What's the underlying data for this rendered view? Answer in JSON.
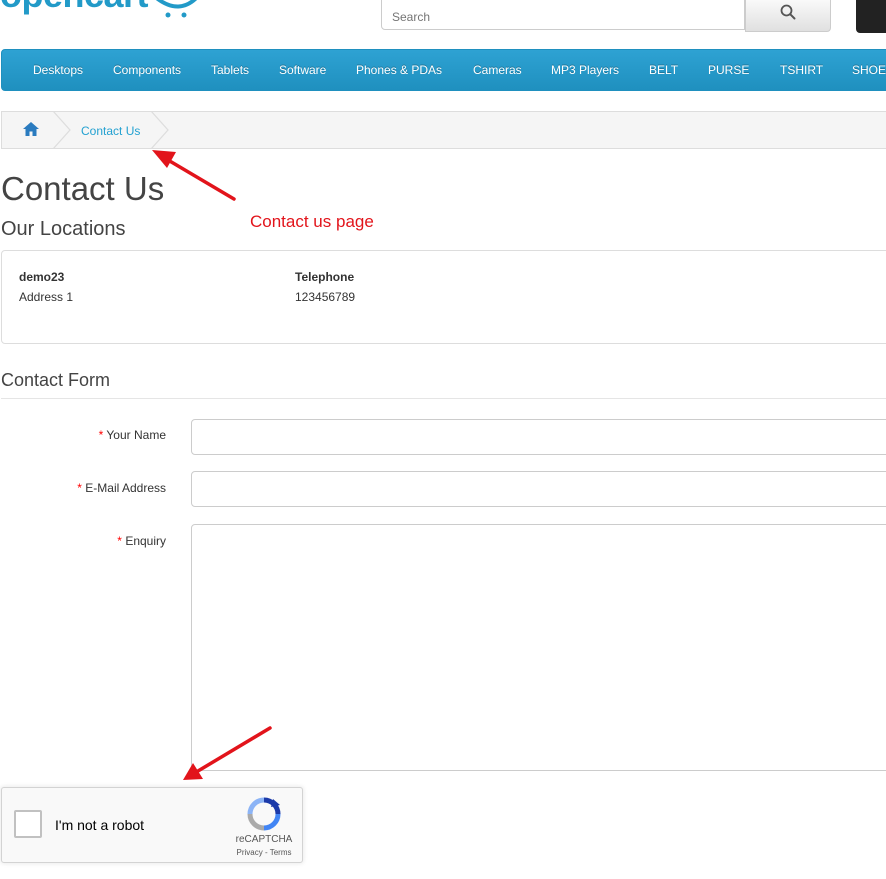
{
  "header": {
    "logo_text": "opencart",
    "search": {
      "placeholder": "Search",
      "value": ""
    }
  },
  "menu": {
    "items": [
      "Desktops",
      "Components",
      "Tablets",
      "Software",
      "Phones & PDAs",
      "Cameras",
      "MP3 Players",
      "BELT",
      "PURSE",
      "TSHIRT",
      "SHOE"
    ]
  },
  "breadcrumb": {
    "current": "Contact Us"
  },
  "page": {
    "title": "Contact Us",
    "locations_heading": "Our Locations",
    "location": {
      "name": "demo23",
      "address": "Address 1",
      "telephone_label": "Telephone",
      "telephone": "123456789"
    }
  },
  "form": {
    "legend": "Contact Form",
    "required_mark": "*",
    "name_label": "Your Name",
    "email_label": "E-Mail Address",
    "enquiry_label": "Enquiry",
    "name_value": "",
    "email_value": "",
    "enquiry_value": ""
  },
  "recaptcha": {
    "label": "I'm not a robot",
    "brand": "reCAPTCHA",
    "privacy": "Privacy",
    "separator": "-",
    "terms": "Terms"
  },
  "annotation": {
    "label": "Contact us page",
    "color": "#e2141b"
  },
  "colors": {
    "brand": "#229ac8",
    "menu_bg": "#229ac8",
    "link": "#23a1d1",
    "required": "#ff0000"
  },
  "icons": {
    "search": "search-icon",
    "home": "home-icon",
    "cart": "cart-icon",
    "recaptcha": "recaptcha-logo-icon"
  }
}
